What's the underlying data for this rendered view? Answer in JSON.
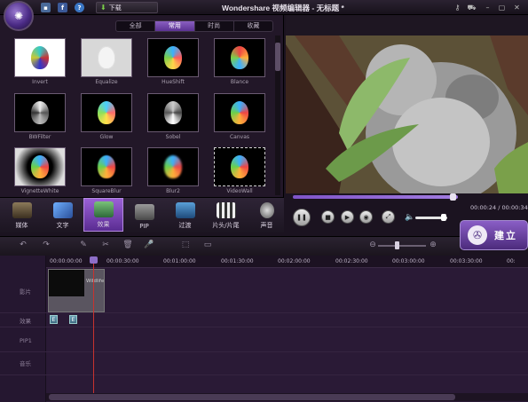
{
  "titlebar": {
    "download_label": "下载",
    "title": "Wondershare 视频编辑器 - 无标题 *"
  },
  "filter_tabs": [
    "全部",
    "常用",
    "时尚",
    "收藏"
  ],
  "effects": [
    {
      "label": "Invert"
    },
    {
      "label": "Equalize"
    },
    {
      "label": "HueShift"
    },
    {
      "label": "Blance"
    },
    {
      "label": "BWFilter"
    },
    {
      "label": "Glow"
    },
    {
      "label": "Sobel"
    },
    {
      "label": "Canvas"
    },
    {
      "label": "VignetteWhite"
    },
    {
      "label": "SquareBlur"
    },
    {
      "label": "Blur2"
    },
    {
      "label": "VideoWall"
    }
  ],
  "categories": [
    "媒体",
    "文字",
    "效果",
    "PIP",
    "过渡",
    "片头/片尾",
    "声音"
  ],
  "player": {
    "time": "00:00:24 / 00:00:34",
    "progress": 0.97,
    "volume": 0.9
  },
  "create_label": "建立",
  "ruler_ticks": [
    "00:00:00:00",
    "00:00:30:00",
    "00:01:00:00",
    "00:01:30:00",
    "00:02:00:00",
    "00:02:30:00",
    "00:03:00:00",
    "00:03:30:00",
    "00:"
  ],
  "tracks": [
    "影片",
    "效果",
    "PIP1",
    "音乐"
  ],
  "clip_name": "Wildlife",
  "fx_marker": "E",
  "colors": {
    "accent": "#7f54c8",
    "playhead": "#c7332f",
    "background": "#1b1320"
  }
}
